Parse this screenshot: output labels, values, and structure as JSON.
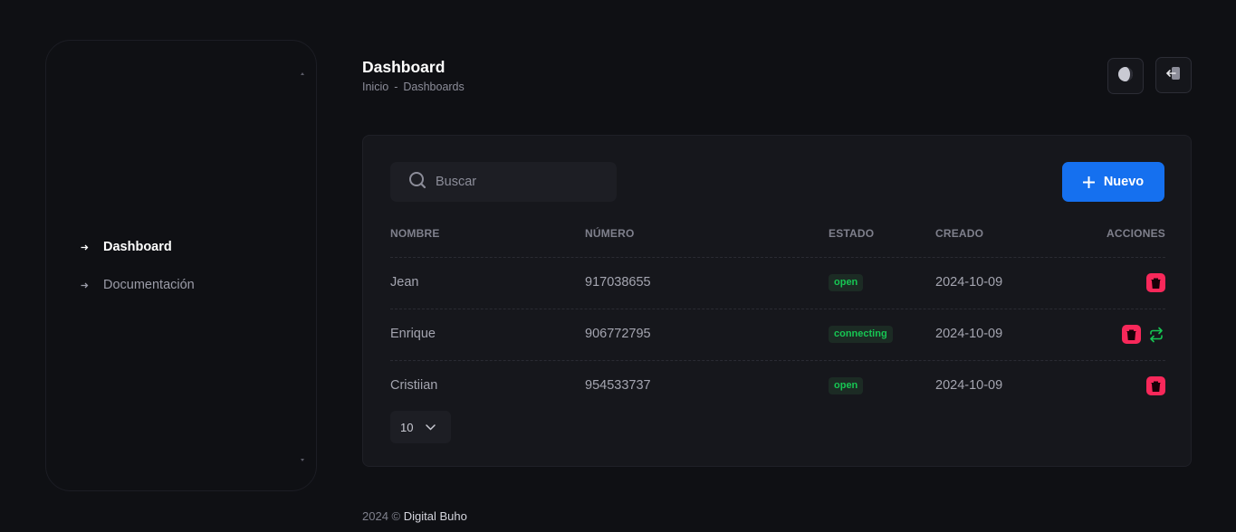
{
  "sidebar": {
    "items": [
      {
        "label": "Dashboard",
        "active": true
      },
      {
        "label": "Documentación",
        "active": false
      }
    ]
  },
  "header": {
    "title": "Dashboard",
    "breadcrumb": [
      "Inicio",
      "-",
      "Dashboards"
    ]
  },
  "toolbar": {
    "search_placeholder": "Buscar",
    "new_label": "Nuevo"
  },
  "table": {
    "columns": [
      "NOMBRE",
      "NÚMERO",
      "ESTADO",
      "CREADO",
      "ACCIONES"
    ],
    "rows": [
      {
        "nombre": "Jean",
        "numero": "917038655",
        "estado": "open",
        "creado": "2024-10-09",
        "actions": [
          "delete"
        ]
      },
      {
        "nombre": "Enrique",
        "numero": "906772795",
        "estado": "connecting",
        "creado": "2024-10-09",
        "actions": [
          "delete",
          "reconnect"
        ]
      },
      {
        "nombre": "Cristiian",
        "numero": "954533737",
        "estado": "open",
        "creado": "2024-10-09",
        "actions": [
          "delete"
        ]
      }
    ]
  },
  "pagination": {
    "page_size": "10"
  },
  "footer": {
    "year": "2024 ©",
    "brand": "Digital Buho"
  },
  "colors": {
    "background": "#0f1014",
    "card": "#16171c",
    "primary": "#1570ef",
    "danger": "#f8285a",
    "success": "#17c653"
  }
}
